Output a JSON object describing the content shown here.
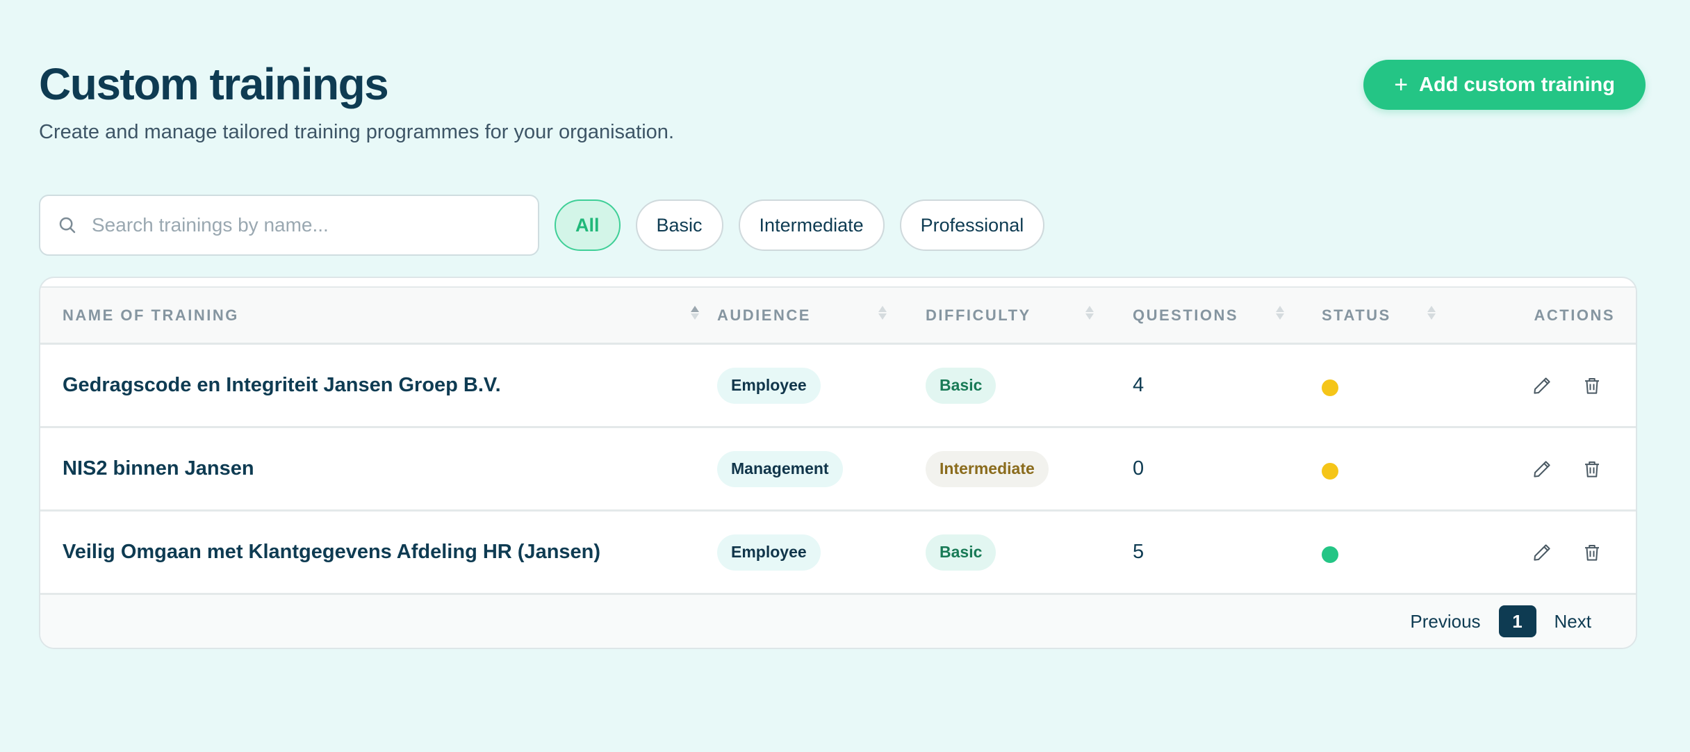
{
  "header": {
    "title": "Custom trainings",
    "subtitle": "Create and manage tailored training programmes for your organisation.",
    "add_button_icon": "plus-icon",
    "add_button_label": "Add custom training"
  },
  "search": {
    "icon": "search-icon",
    "placeholder": "Search trainings by name...",
    "value": ""
  },
  "filters": [
    {
      "label": "All",
      "active": true
    },
    {
      "label": "Basic",
      "active": false
    },
    {
      "label": "Intermediate",
      "active": false
    },
    {
      "label": "Professional",
      "active": false
    }
  ],
  "table": {
    "columns": {
      "name": "NAME OF TRAINING",
      "audience": "AUDIENCE",
      "difficulty": "DIFFICULTY",
      "questions": "QUESTIONS",
      "status": "STATUS",
      "actions": "ACTIONS"
    },
    "rows": [
      {
        "name": "Gedragscode en Integriteit Jansen Groep B.V.",
        "audience": "Employee",
        "difficulty": "Basic",
        "questions": "4",
        "status_color": "#f5c518"
      },
      {
        "name": "NIS2 binnen Jansen",
        "audience": "Management",
        "difficulty": "Intermediate",
        "questions": "0",
        "status_color": "#f5c518"
      },
      {
        "name": "Veilig Omgaan met Klantgegevens Afdeling HR (Jansen)",
        "audience": "Employee",
        "difficulty": "Basic",
        "questions": "5",
        "status_color": "#24c585"
      }
    ]
  },
  "pagination": {
    "previous": "Previous",
    "current_page": "1",
    "next": "Next"
  },
  "colors": {
    "background": "#e8f9f8",
    "primary": "#24c585",
    "text_dark": "#0e3b52"
  }
}
